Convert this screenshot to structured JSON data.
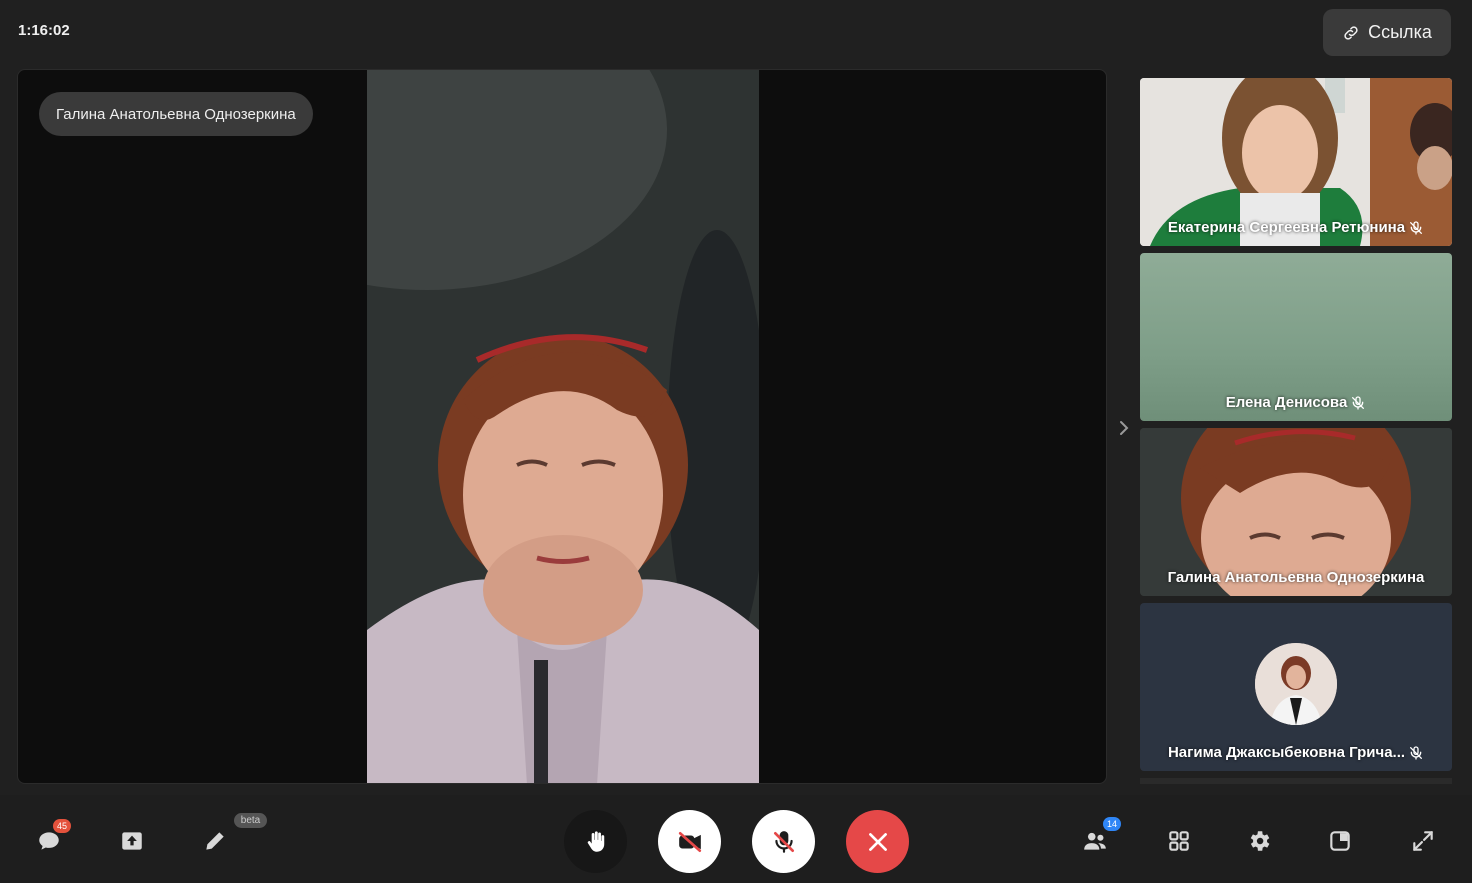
{
  "header": {
    "timer": "1:16:02",
    "link_button": "Ссылка"
  },
  "main": {
    "speaker_name": "Галина Анатольевна Однозеркина"
  },
  "participants": [
    {
      "name": "Екатерина Сергеевна Ретюнина",
      "muted": true
    },
    {
      "name": "Елена Денисова",
      "muted": true
    },
    {
      "name": "Галина Анатольевна Однозеркина",
      "muted": false
    },
    {
      "name": "Нагима Джаксыбековна Грича...",
      "muted": true
    }
  ],
  "toolbar": {
    "chat_badge": "45",
    "draw_beta": "beta",
    "participants_badge": "14"
  },
  "colors": {
    "end_call": "#e54848",
    "badge_chat": "#e4523c",
    "badge_participants": "#2f86f6"
  }
}
